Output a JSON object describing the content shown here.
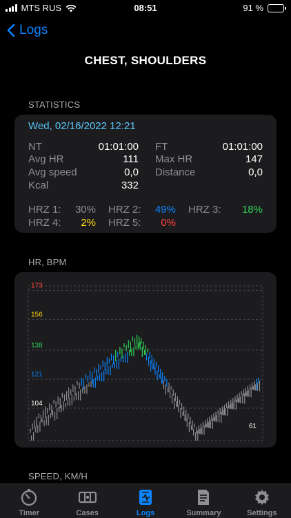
{
  "status": {
    "carrier": "MTS RUS",
    "time": "08:51",
    "battery": "91 %",
    "battery_level": 0.91
  },
  "nav": {
    "back_label": "Logs"
  },
  "title": "CHEST, SHOULDERS",
  "statistics": {
    "section_label": "STATISTICS",
    "date": "Wed, 02/16/2022 12:21",
    "items": [
      {
        "label": "NT",
        "value": "01:01:00"
      },
      {
        "label": "FT",
        "value": "01:01:00"
      },
      {
        "label": "Avg HR",
        "value": "111"
      },
      {
        "label": "Max HR",
        "value": "147"
      },
      {
        "label": "Avg speed",
        "value": "0,0"
      },
      {
        "label": "Distance",
        "value": "0,0"
      },
      {
        "label": "Kcal",
        "value": "332"
      }
    ],
    "zones": [
      {
        "label": "HRZ 1:",
        "value": "30%",
        "color": "#8e8e93"
      },
      {
        "label": "HRZ 2:",
        "value": "49%",
        "color": "#0a84ff"
      },
      {
        "label": "HRZ 3:",
        "value": "18%",
        "color": "#30d158"
      },
      {
        "label": "HRZ 4:",
        "value": "2%",
        "color": "#ffd60a"
      },
      {
        "label": "HRZ 5:",
        "value": "0%",
        "color": "#ff453a"
      }
    ]
  },
  "hr_section_label": "HR, BPM",
  "speed_section_label": "SPEED, KM/H",
  "chart_data": {
    "type": "bar",
    "ylabel": "HR, BPM",
    "ylim": [
      85,
      178
    ],
    "zone_thresholds": [
      {
        "value": 173,
        "color": "#ff453a"
      },
      {
        "value": 156,
        "color": "#ffd60a"
      },
      {
        "value": 138,
        "color": "#30d158"
      },
      {
        "value": 121,
        "color": "#0a84ff"
      },
      {
        "value": 104,
        "color": "#ffffff"
      }
    ],
    "tick_labels": [
      "173",
      "156",
      "138",
      "121",
      "104"
    ],
    "min_label": "61",
    "x_points": 220,
    "series": [
      {
        "values": [
          92,
          88,
          95,
          90,
          97,
          93,
          99,
          94,
          101,
          96,
          100,
          98,
          103,
          97,
          105,
          99,
          104,
          100,
          107,
          101,
          106,
          103,
          109,
          102,
          108,
          104,
          111,
          105,
          110,
          106,
          113,
          108,
          112,
          107,
          114,
          109,
          116,
          110,
          115,
          112,
          118,
          111,
          117,
          113,
          120,
          114,
          119,
          115,
          122,
          116,
          121,
          117,
          124,
          118,
          123,
          119,
          126,
          120,
          125,
          121,
          128,
          122,
          127,
          123,
          130,
          124,
          129,
          125,
          132,
          126,
          131,
          127,
          134,
          128,
          133,
          129,
          136,
          130,
          135,
          131,
          138,
          132,
          137,
          133,
          140,
          134,
          139,
          135,
          142,
          136,
          141,
          137,
          144,
          138,
          143,
          139,
          146,
          140,
          145,
          141,
          147,
          142,
          146,
          143,
          145,
          140,
          143,
          138,
          141,
          136,
          139,
          134,
          137,
          132,
          135,
          130,
          133,
          128,
          131,
          126,
          129,
          124,
          127,
          122,
          125,
          120,
          123,
          118,
          121,
          116,
          119,
          114,
          117,
          112,
          115,
          110,
          113,
          108,
          111,
          106,
          109,
          104,
          107,
          102,
          105,
          100,
          103,
          98,
          101,
          96,
          99,
          94,
          97,
          92,
          95,
          90,
          93,
          91,
          94,
          92,
          95,
          93,
          96,
          94,
          97,
          95,
          98,
          96,
          99,
          97,
          100,
          98,
          101,
          99,
          102,
          100,
          103,
          101,
          104,
          102,
          105,
          103,
          106,
          104,
          107,
          105,
          108,
          106,
          109,
          107,
          110,
          108,
          111,
          109,
          112,
          110,
          113,
          111,
          114,
          112,
          115,
          113,
          116,
          114,
          117,
          115,
          118,
          116,
          119,
          117,
          120,
          118,
          121,
          119,
          122,
          120
        ]
      }
    ]
  },
  "tabs": [
    {
      "label": "Timer",
      "icon": "timer-icon"
    },
    {
      "label": "Cases",
      "icon": "cases-icon"
    },
    {
      "label": "Logs",
      "icon": "logs-icon"
    },
    {
      "label": "Summary",
      "icon": "summary-icon"
    },
    {
      "label": "Settings",
      "icon": "settings-icon"
    }
  ]
}
